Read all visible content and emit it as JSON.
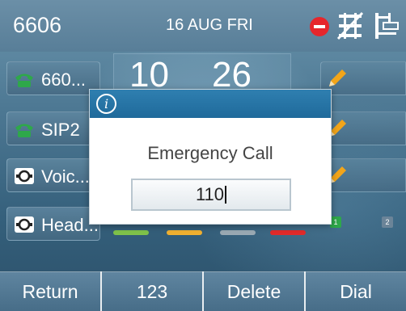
{
  "status_bar": {
    "extension": "6606",
    "date": "16 AUG FRI",
    "icons": [
      "dnd-icon",
      "network-unavailable-icon",
      "lan-disconnected-icon"
    ]
  },
  "line_keys": [
    {
      "label": "660...",
      "icon": "phone-icon"
    },
    {
      "label": "SIP2",
      "icon": "phone-icon"
    },
    {
      "label": "Voic...",
      "icon": "voicemail-icon"
    },
    {
      "label": "Head...",
      "icon": "headset-icon"
    }
  ],
  "clock": {
    "hour": "10",
    "minute": "26"
  },
  "right_keys": [
    {
      "icon": "edit-icon"
    },
    {
      "icon": "edit-icon"
    },
    {
      "icon": "edit-icon"
    }
  ],
  "page_badges": [
    "1",
    "2"
  ],
  "dialog": {
    "icon": "info-icon",
    "title": "Emergency Call",
    "input_value": "110"
  },
  "softkeys": [
    "Return",
    "123",
    "Delete",
    "Dial"
  ],
  "colors": {
    "dialog_header": "#1f6a9b",
    "softkey": "#476d88",
    "dnd": "#e6262c"
  }
}
